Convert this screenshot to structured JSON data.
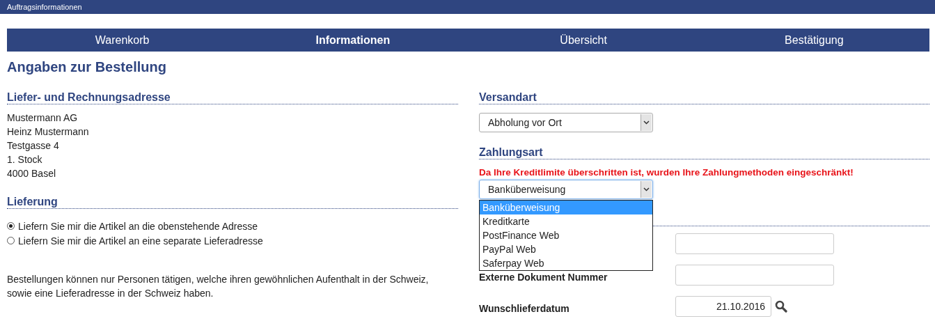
{
  "header": {
    "title": "Auftragsinformationen"
  },
  "steps": [
    {
      "label": "Warenkorb",
      "selected": false
    },
    {
      "label": "Informationen",
      "selected": true
    },
    {
      "label": "Übersicht",
      "selected": false
    },
    {
      "label": "Bestätigung",
      "selected": false
    }
  ],
  "page_title": "Angaben zur Bestellung",
  "address": {
    "heading": "Liefer- und Rechnungsadresse",
    "lines": [
      "Mustermann AG",
      "Heinz Mustermann",
      "Testgasse 4",
      "1. Stock",
      "4000 Basel"
    ]
  },
  "delivery": {
    "heading": "Lieferung",
    "options": [
      {
        "label": "Liefern Sie mir die Artikel an die obenstehende Adresse",
        "selected": true
      },
      {
        "label": "Liefern Sie mir die Artikel an eine separate Lieferadresse",
        "selected": false
      }
    ]
  },
  "notice": "Bestellungen können nur Personen tätigen, welche ihren gewöhnlichen Aufenthalt in der Schweiz, sowie eine Lieferadresse in der Schweiz haben.",
  "shipping": {
    "heading": "Versandart",
    "value": "Abholung vor Ort"
  },
  "payment": {
    "heading": "Zahlungsart",
    "warning": "Da Ihre Kreditlimite überschritten ist, wurden Ihre Zahlungmethoden eingeschränkt!",
    "value": "Banküberweisung",
    "expanded": true,
    "options": [
      {
        "label": "Banküberweisung",
        "selected": true
      },
      {
        "label": "Kreditkarte",
        "selected": false
      },
      {
        "label": "PostFinance Web",
        "selected": false
      },
      {
        "label": "PayPal Web",
        "selected": false
      },
      {
        "label": "Saferpay Web",
        "selected": false
      }
    ]
  },
  "fields": [
    {
      "kind": "text"
    },
    {
      "kind": "text",
      "label": "Externe Dokument Nummer"
    },
    {
      "kind": "date",
      "label": "Wunschlieferdatum",
      "value": "21.10.2016"
    }
  ]
}
